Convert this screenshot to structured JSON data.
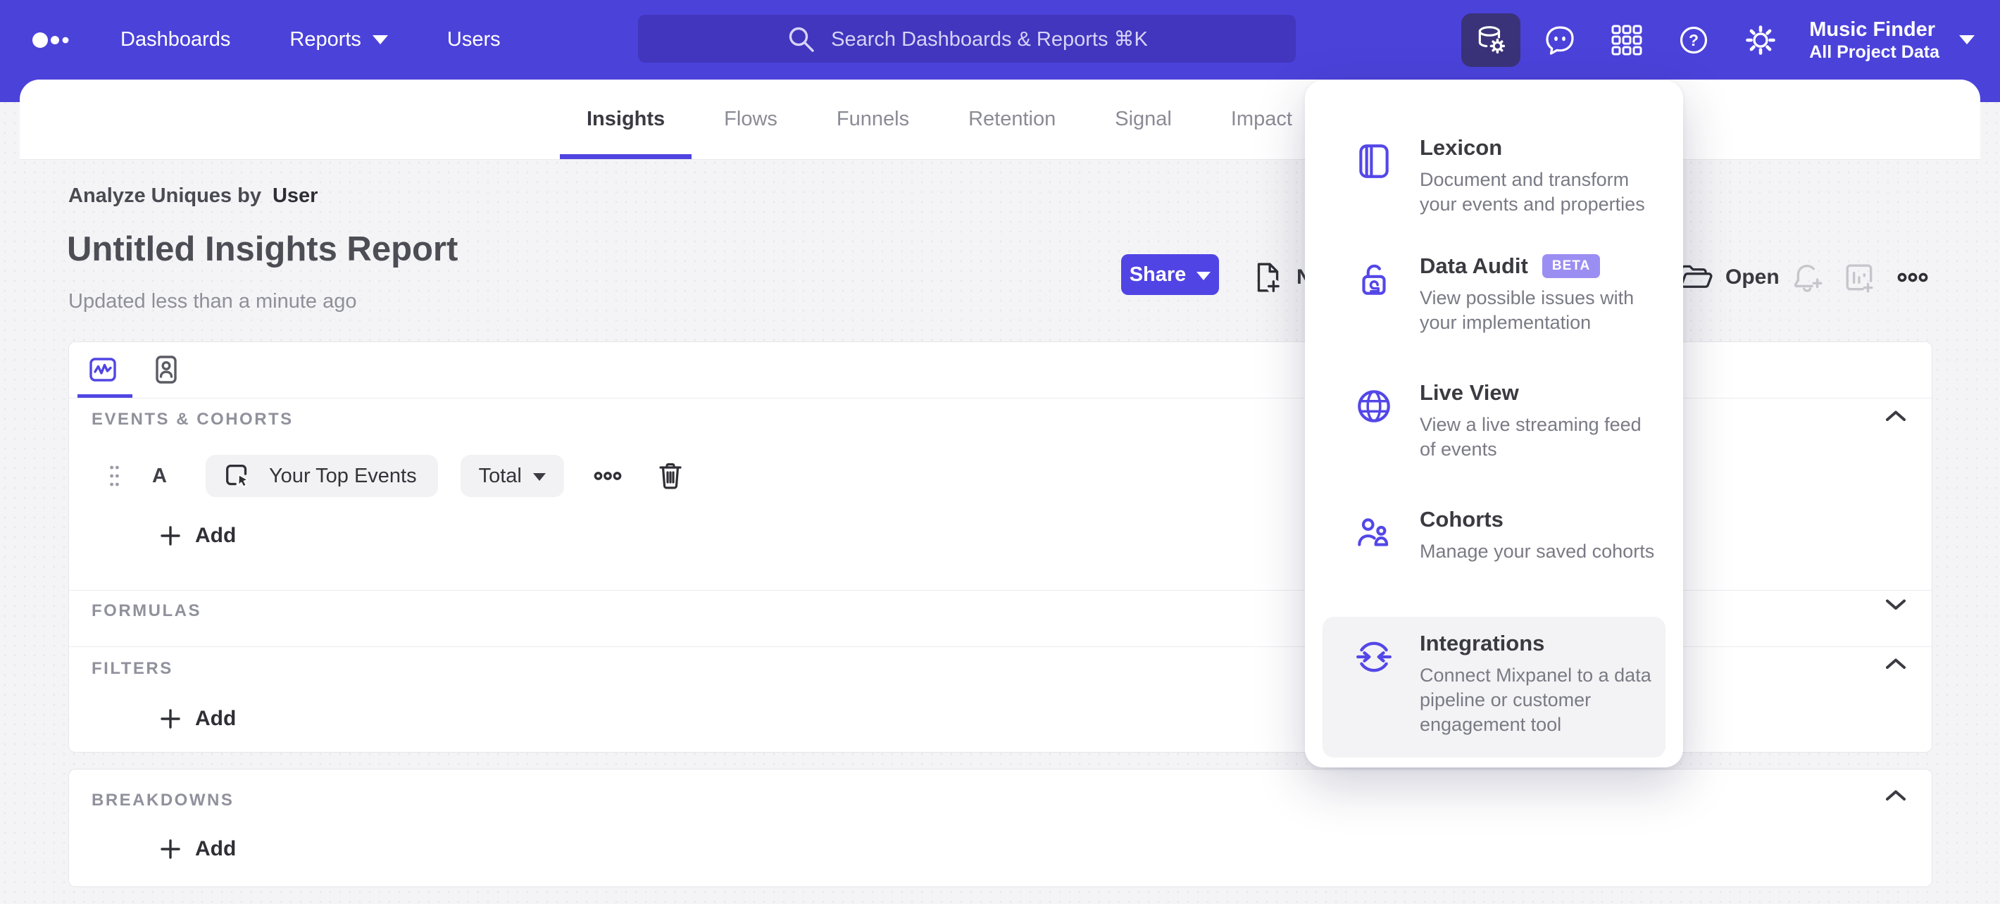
{
  "nav": {
    "items": [
      {
        "label": "Dashboards"
      },
      {
        "label": "Reports"
      },
      {
        "label": "Users"
      }
    ],
    "search": {
      "placeholder": "Search Dashboards & Reports ⌘K"
    },
    "project": {
      "name": "Music Finder",
      "scope": "All Project Data"
    }
  },
  "tabs": {
    "items": [
      {
        "label": "Insights"
      },
      {
        "label": "Flows"
      },
      {
        "label": "Funnels"
      },
      {
        "label": "Retention"
      },
      {
        "label": "Signal"
      },
      {
        "label": "Impact"
      }
    ]
  },
  "report": {
    "analyze_prefix": "Analyze Uniques by",
    "analyze_value": "User",
    "title": "Untitled Insights Report",
    "updated": "Updated less than a minute ago",
    "share_label": "Share",
    "new_label": "New",
    "open_label": "Open"
  },
  "builder": {
    "sections": {
      "events": {
        "label": "EVENTS & COHORTS"
      },
      "formulas": {
        "label": "FORMULAS"
      },
      "filters": {
        "label": "FILTERS"
      },
      "breakdowns": {
        "label": "BREAKDOWNS"
      }
    },
    "event_row": {
      "letter": "A",
      "event": "Your Top Events",
      "metric": "Total"
    },
    "add_label": "Add"
  },
  "panel": {
    "items": [
      {
        "title": "Lexicon",
        "desc": "Document and transform your events and properties"
      },
      {
        "title": "Data Audit",
        "badge": "BETA",
        "desc": "View possible issues with your implementation"
      },
      {
        "title": "Live View",
        "desc": "View a live streaming feed of events"
      },
      {
        "title": "Cohorts",
        "desc": "Manage your saved cohorts"
      },
      {
        "title": "Integrations",
        "desc": "Connect Mixpanel to a data pipeline or customer engagement tool"
      }
    ]
  },
  "colors": {
    "brand_purple": "#4b42da",
    "accent": "#5046e4",
    "search_bg": "#4136bd",
    "active_icon_bg": "#3a3379",
    "beta_badge": "#9b8ef2",
    "page_bg": "#f4f4f6"
  }
}
